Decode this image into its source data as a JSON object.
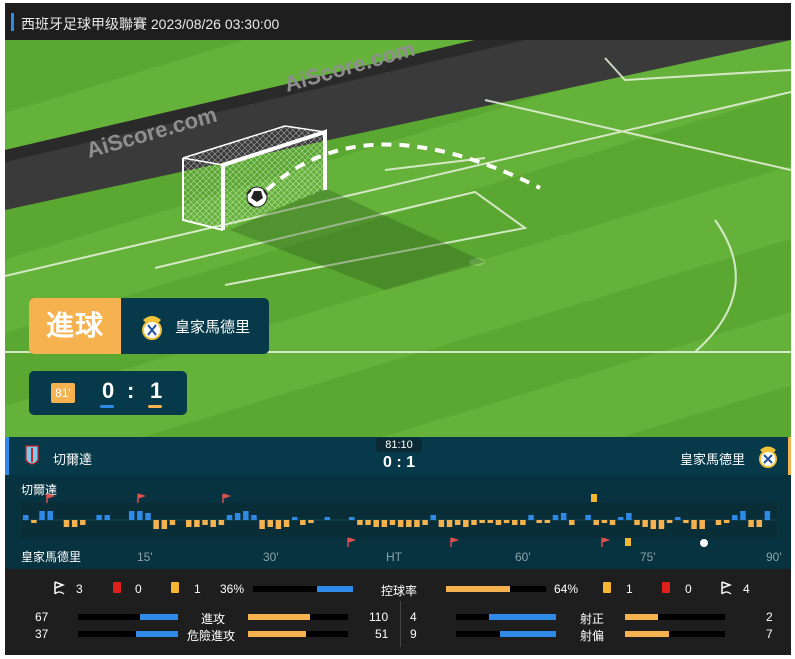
{
  "header": {
    "title": "西班牙足球甲级聯賽 2023/08/26 03:30:00"
  },
  "pitch": {
    "watermarks": [
      "AiScore.com",
      "AiScore.com"
    ],
    "goal_banner": {
      "label": "進球",
      "team": "皇家馬德里"
    },
    "score_box": {
      "minute": "81'",
      "home_score": "0",
      "separator": ":",
      "away_score": "1"
    }
  },
  "teams_bar": {
    "home_name": "切爾達",
    "away_name": "皇家馬德里",
    "clock": "81:10",
    "score": "0 : 1"
  },
  "timeline": {
    "home_label": "切爾達",
    "away_label": "皇家馬德里",
    "ticks": [
      "15'",
      "30'",
      "HT",
      "60'",
      "75'",
      "90'"
    ]
  },
  "stats": {
    "home_corners": "3",
    "home_red": "0",
    "home_yellow": "1",
    "home_possession": "36%",
    "possession_label": "控球率",
    "away_possession": "64%",
    "away_yellow": "1",
    "away_red": "0",
    "away_corners": "4",
    "possession_home_fraction": 0.36,
    "possession_away_fraction": 0.64,
    "rows": [
      {
        "label": "進攻",
        "home": "67",
        "away": "110",
        "home_fraction": 0.38,
        "away_fraction": 0.62
      },
      {
        "label": "危險進攻",
        "home": "37",
        "away": "51",
        "home_fraction": 0.42,
        "away_fraction": 0.58
      }
    ],
    "shots": [
      {
        "label": "射正",
        "home": "4",
        "away": "2",
        "home_fraction": 0.67,
        "away_fraction": 0.33
      },
      {
        "label": "射偏",
        "home": "9",
        "away": "7",
        "home_fraction": 0.56,
        "away_fraction": 0.44
      }
    ]
  },
  "colors": {
    "home": "#2e8ae6",
    "away": "#f5b24f",
    "red_card": "#e0201c",
    "yellow_card": "#f5b731"
  }
}
